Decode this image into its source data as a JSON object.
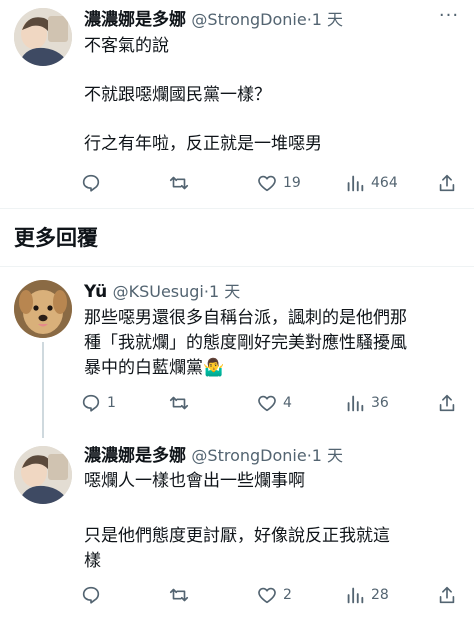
{
  "tweets": [
    {
      "name": "濃濃娜是多娜",
      "handle": "@StrongDonie",
      "time": "1 天",
      "lines": [
        "不客氣的說",
        "",
        "不就跟噁爛國民黨一樣？",
        "",
        "行之有年啦，反正就是一堆噁男"
      ],
      "replies": "",
      "retweets": "",
      "likes": "19",
      "views": "464"
    },
    {
      "name": "Yü",
      "handle": "@KSUesugi",
      "time": "1 天",
      "lines": [
        "那些噁男還很多自稱台派，諷刺的是他們那",
        "種「我就爛」的態度剛好完美對應性騷擾風",
        "暴中的白藍爛黨🤷‍♂️"
      ],
      "replies": "1",
      "retweets": "",
      "likes": "4",
      "views": "36"
    },
    {
      "name": "濃濃娜是多娜",
      "handle": "@StrongDonie",
      "time": "1 天",
      "lines": [
        "噁爛人一樣也會出一些爛事啊",
        "",
        "只是他們態度更討厭，好像說反正我就這",
        "樣"
      ],
      "replies": "",
      "retweets": "",
      "likes": "2",
      "views": "28"
    }
  ],
  "more_replies_title": "更多回覆",
  "dot": "·",
  "more_glyph": "···",
  "colors": {
    "text": "#0f1419",
    "muted": "#536471",
    "divider": "#eff3f4"
  }
}
